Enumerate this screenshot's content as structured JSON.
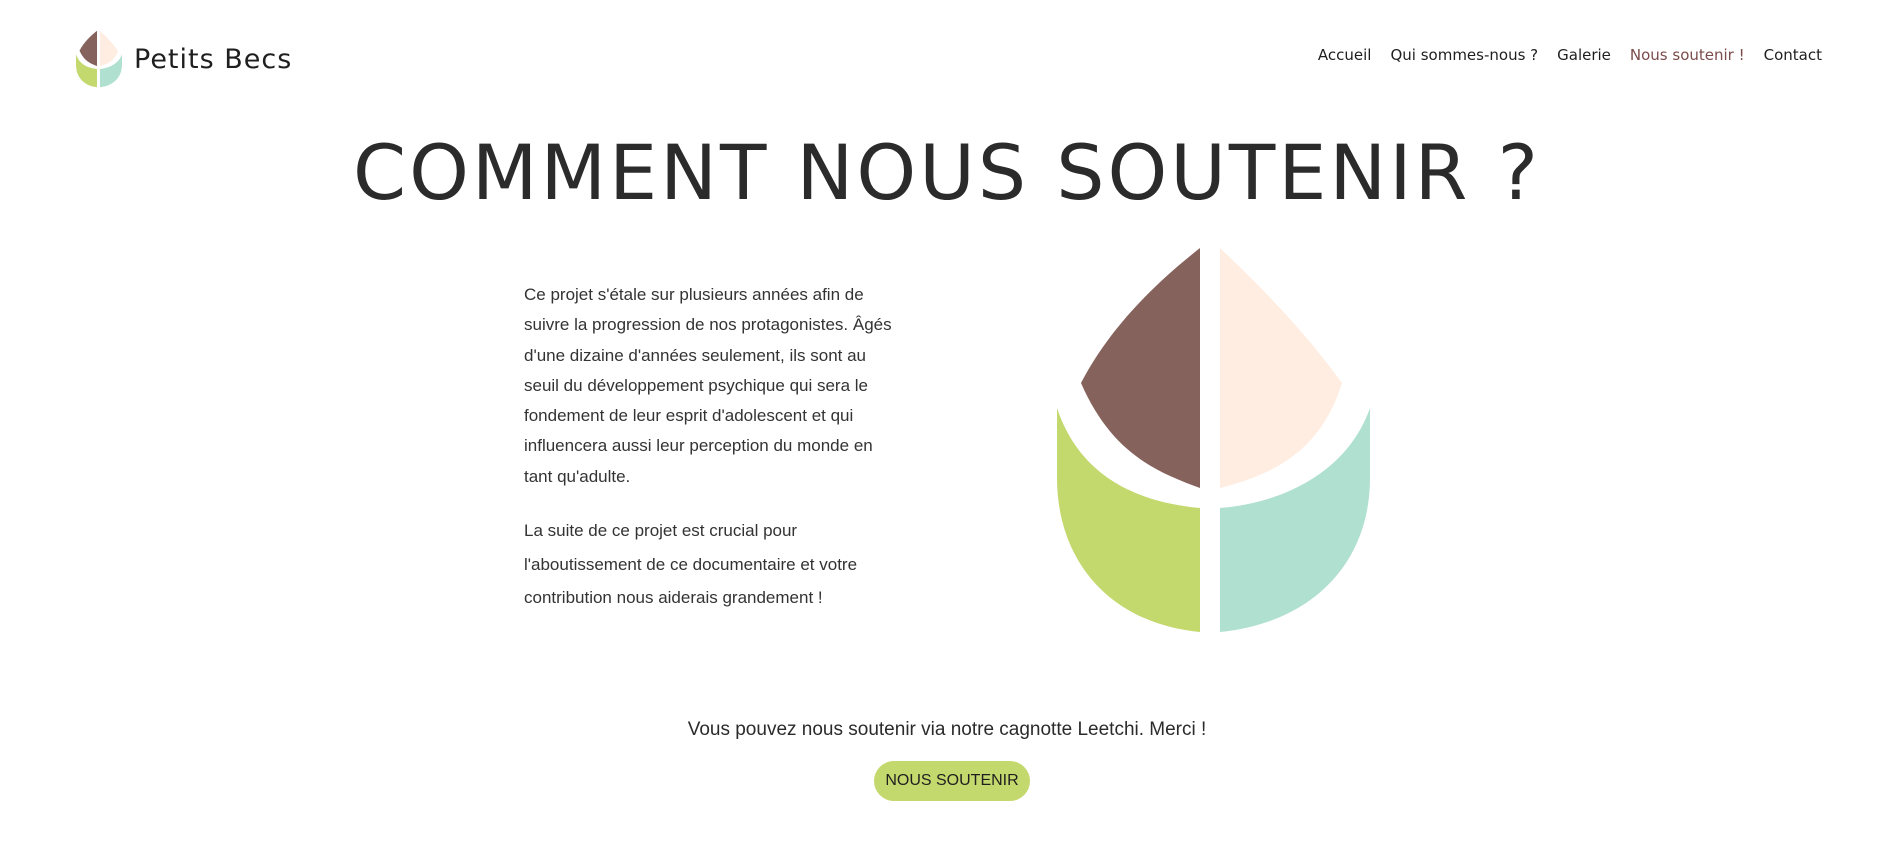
{
  "brand": {
    "name": "Petits Becs",
    "logo_icon": "leaf-drop-logo-icon"
  },
  "nav": {
    "items": [
      {
        "label": "Accueil"
      },
      {
        "label": "Qui sommes-nous ?"
      },
      {
        "label": "Galerie"
      },
      {
        "label": "Nous soutenir !",
        "active": true
      },
      {
        "label": "Contact"
      }
    ]
  },
  "main": {
    "title": "COMMENT NOUS SOUTENIR ?",
    "paragraph1": "Ce projet s'étale sur plusieurs années afin de suivre la progression de nos protagonistes. Âgés d'une dizaine d'années seulement, ils sont au seuil du développement psychique qui sera le fondement de leur esprit d'adolescent et qui influencera aussi leur perception du monde en tant qu'adulte.",
    "paragraph2": "La suite de ce projet est crucial pour l'aboutissement de ce documentaire et votre contribution nous aiderais grandement !",
    "illustration_icon": "leaf-drop-illustration-icon"
  },
  "cta": {
    "text": "Vous pouvez nous soutenir via notre cagnotte Leetchi. Merci !",
    "button_label": "NOUS SOUTENIR"
  },
  "colors": {
    "brown": "#86625c",
    "peach": "#ffede1",
    "green": "#c3d86d",
    "mint": "#b0e0cf",
    "nav_active": "#7a4c4a",
    "button": "#c3d86d"
  }
}
